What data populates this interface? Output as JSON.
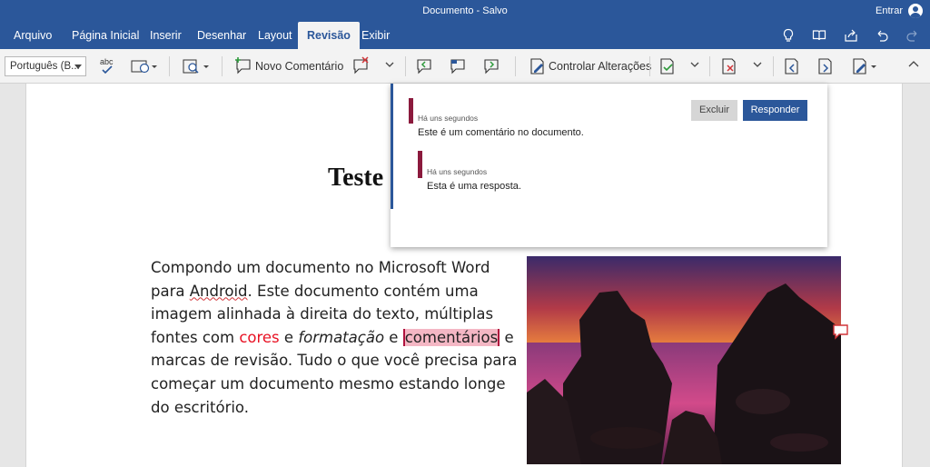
{
  "window": {
    "title": "Documento - Salvo",
    "signin_label": "Entrar"
  },
  "tabs": [
    {
      "label": "Arquivo"
    },
    {
      "label": "Página Inicial"
    },
    {
      "label": "Inserir"
    },
    {
      "label": "Desenhar"
    },
    {
      "label": "Layout"
    },
    {
      "label": "Revisão",
      "active": true
    },
    {
      "label": "Exibir"
    }
  ],
  "tabbar_icons": [
    "lightbulb-icon",
    "book-icon",
    "share-icon",
    "undo-icon",
    "redo-icon"
  ],
  "ribbon": {
    "language": "Português (B...",
    "spelling_icon_text": "abc",
    "new_comment_label": "Novo Comentário",
    "track_changes_label": "Controlar Alterações"
  },
  "document": {
    "heading": "Teste",
    "paragraph": {
      "p1": "Compondo um documento no Microsoft Word para ",
      "android": "Android",
      "p2": ". Este documento contém uma imagem alinhada à direita do texto, múltiplas fontes com ",
      "cores": "cores",
      "p3": " e ",
      "formatacao": "formatação",
      "p4": " e ",
      "comentarios": "comentários",
      "p5": " e marcas de revisão. Tudo o que você precisa para começar um documento mesmo estando longe do escritório."
    }
  },
  "comments": {
    "delete_label": "Excluir",
    "reply_label": "Responder",
    "thread": [
      {
        "time": "Há uns segundos",
        "text": "Este é um comentário no documento."
      },
      {
        "time": "Há uns segundos",
        "text": "Esta é uma resposta."
      }
    ]
  },
  "colors": {
    "accent": "#2b579a",
    "comment_bar": "#8b1a3d",
    "comment_highlight": "#f4b7c4",
    "red_text": "#e81123"
  }
}
